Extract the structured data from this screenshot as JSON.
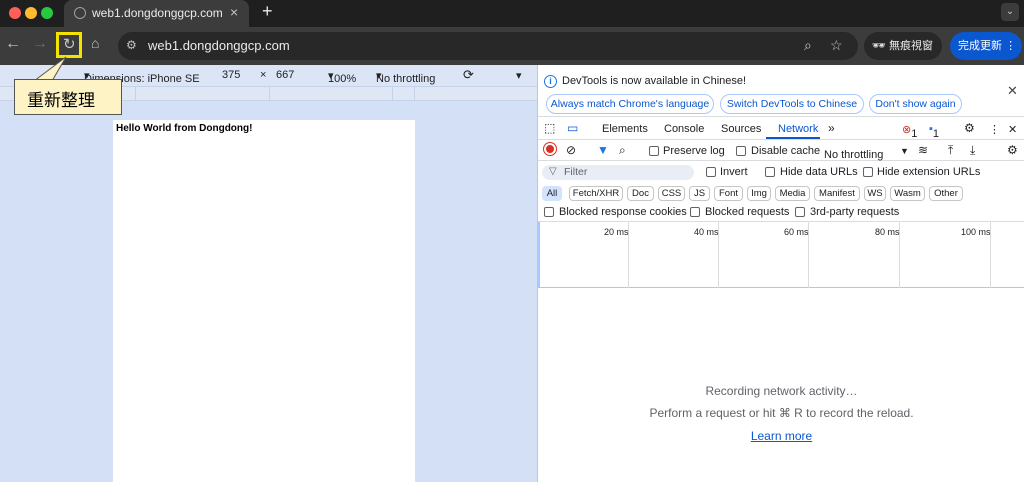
{
  "colors": {
    "tabstrip": "#1f1f1f",
    "toolbar": "#3c3c3c",
    "accent": "#0b57d0",
    "highlight": "#f4e300",
    "callout": "#fdf3c4",
    "device_bg": "#d3e0f5"
  },
  "browser": {
    "tab_title": "web1.dongdonggcp.com",
    "new_tab_icon": "+",
    "url": "web1.dongdonggcp.com",
    "incognito_label": "無痕視窗",
    "update_label": "完成更新"
  },
  "annotation": {
    "callout_text": "重新整理"
  },
  "device_toolbar": {
    "dimensions_label": "Dimensions: iPhone SE",
    "width": "375",
    "times": "×",
    "height": "667",
    "zoom": "100%",
    "throttling": "No throttling"
  },
  "page": {
    "content_text": "Hello World from Dongdong!"
  },
  "devtools": {
    "info_text": "DevTools is now available in Chinese!",
    "info_buttons": [
      "Always match Chrome's language",
      "Switch DevTools to Chinese",
      "Don't show again"
    ],
    "panel_tabs": [
      "Elements",
      "Console",
      "Sources",
      "Network"
    ],
    "more_tabs": "»",
    "error_count": "1",
    "message_count": "1",
    "network_toolbar": {
      "preserve_log": "Preserve log",
      "disable_cache": "Disable cache",
      "throttling": "No throttling"
    },
    "filter_placeholder": "Filter",
    "invert": "Invert",
    "hide_data_urls": "Hide data URLs",
    "hide_extension_urls": "Hide extension URLs",
    "type_chips": [
      "All",
      "Fetch/XHR",
      "Doc",
      "CSS",
      "JS",
      "Font",
      "Img",
      "Media",
      "Manifest",
      "WS",
      "Wasm",
      "Other"
    ],
    "blocked_response_cookies": "Blocked response cookies",
    "blocked_requests": "Blocked requests",
    "third_party_requests": "3rd-party requests",
    "timeline_ticks": [
      "20 ms",
      "40 ms",
      "60 ms",
      "80 ms",
      "100 ms"
    ],
    "empty_title": "Recording network activity…",
    "empty_hint": "Perform a request or hit ⌘ R to record the reload.",
    "learn_more": "Learn more"
  }
}
